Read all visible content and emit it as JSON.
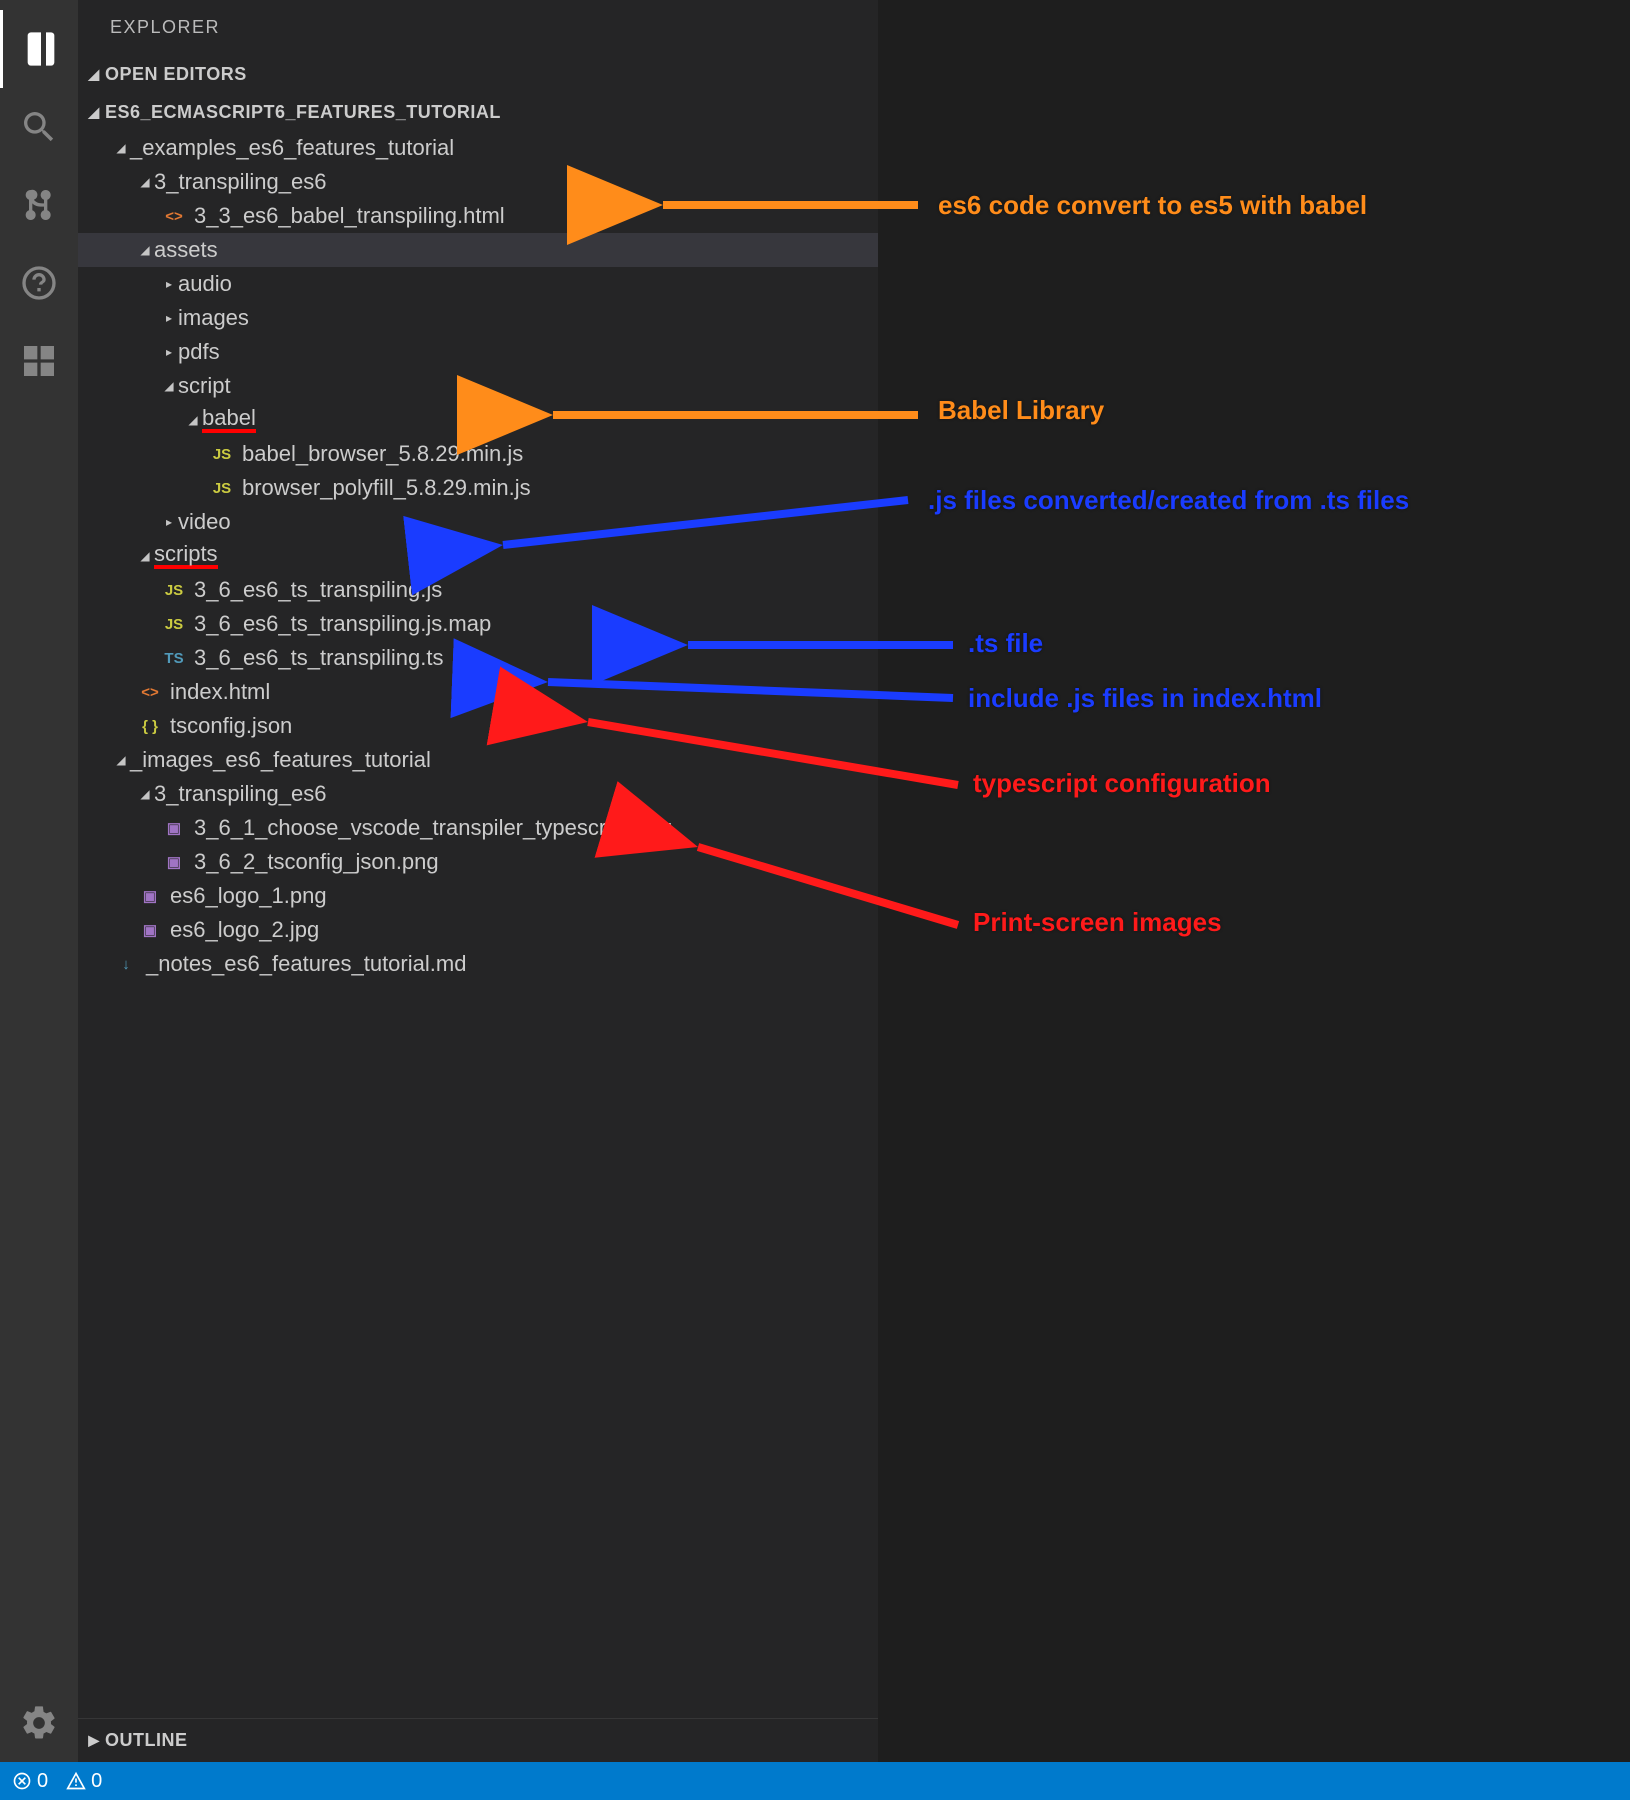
{
  "explorer": {
    "title": "EXPLORER",
    "open_editors_label": "OPEN EDITORS",
    "outline_label": "OUTLINE",
    "project_name": "ES6_ECMASCRIPT6_FEATURES_TUTORIAL"
  },
  "tree": [
    {
      "depth": 1,
      "type": "folder",
      "open": true,
      "label": "_examples_es6_features_tutorial"
    },
    {
      "depth": 2,
      "type": "folder",
      "open": true,
      "label": "3_transpiling_es6"
    },
    {
      "depth": 3,
      "type": "file",
      "badge": "html",
      "badgeText": "<>",
      "label": "3_3_es6_babel_transpiling.html",
      "selected": false
    },
    {
      "depth": 2,
      "type": "folder",
      "open": true,
      "label": "assets",
      "selected": true
    },
    {
      "depth": 3,
      "type": "folder",
      "open": false,
      "label": "audio"
    },
    {
      "depth": 3,
      "type": "folder",
      "open": false,
      "label": "images"
    },
    {
      "depth": 3,
      "type": "folder",
      "open": false,
      "label": "pdfs"
    },
    {
      "depth": 3,
      "type": "folder",
      "open": true,
      "label": "script"
    },
    {
      "depth": 4,
      "type": "folder",
      "open": true,
      "label": "babel",
      "underline": true
    },
    {
      "depth": 5,
      "type": "file",
      "badge": "js",
      "badgeText": "JS",
      "label": "babel_browser_5.8.29.min.js"
    },
    {
      "depth": 5,
      "type": "file",
      "badge": "js",
      "badgeText": "JS",
      "label": "browser_polyfill_5.8.29.min.js"
    },
    {
      "depth": 3,
      "type": "folder",
      "open": false,
      "label": "video"
    },
    {
      "depth": 2,
      "type": "folder",
      "open": true,
      "label": "scripts",
      "underline": true
    },
    {
      "depth": 3,
      "type": "file",
      "badge": "js",
      "badgeText": "JS",
      "label": "3_6_es6_ts_transpiling.js"
    },
    {
      "depth": 3,
      "type": "file",
      "badge": "js",
      "badgeText": "JS",
      "label": "3_6_es6_ts_transpiling.js.map"
    },
    {
      "depth": 3,
      "type": "file",
      "badge": "ts",
      "badgeText": "TS",
      "label": "3_6_es6_ts_transpiling.ts"
    },
    {
      "depth": 2,
      "type": "file",
      "badge": "html",
      "badgeText": "<>",
      "label": "index.html"
    },
    {
      "depth": 2,
      "type": "file",
      "badge": "json",
      "badgeText": "{ }",
      "label": "tsconfig.json"
    },
    {
      "depth": 1,
      "type": "folder",
      "open": true,
      "label": "_images_es6_features_tutorial"
    },
    {
      "depth": 2,
      "type": "folder",
      "open": true,
      "label": "3_transpiling_es6"
    },
    {
      "depth": 3,
      "type": "file",
      "badge": "img",
      "badgeText": "▣",
      "label": "3_6_1_choose_vscode_transpiler_typescript.png"
    },
    {
      "depth": 3,
      "type": "file",
      "badge": "img",
      "badgeText": "▣",
      "label": "3_6_2_tsconfig_json.png"
    },
    {
      "depth": 2,
      "type": "file",
      "badge": "img",
      "badgeText": "▣",
      "label": "es6_logo_1.png"
    },
    {
      "depth": 2,
      "type": "file",
      "badge": "img",
      "badgeText": "▣",
      "label": "es6_logo_2.jpg"
    },
    {
      "depth": 1,
      "type": "file",
      "badge": "md",
      "badgeText": "↓",
      "label": "_notes_es6_features_tutorial.md"
    }
  ],
  "statusbar": {
    "errors": "0",
    "warnings": "0"
  },
  "annotations": {
    "a1": "es6 code convert to es5  with babel",
    "a2": "Babel  Library",
    "a3": ".js files converted/created from .ts files",
    "a4": ".ts file",
    "a5": "include .js files in index.html",
    "a6": "typescript configuration",
    "a7": "Print-screen images"
  }
}
